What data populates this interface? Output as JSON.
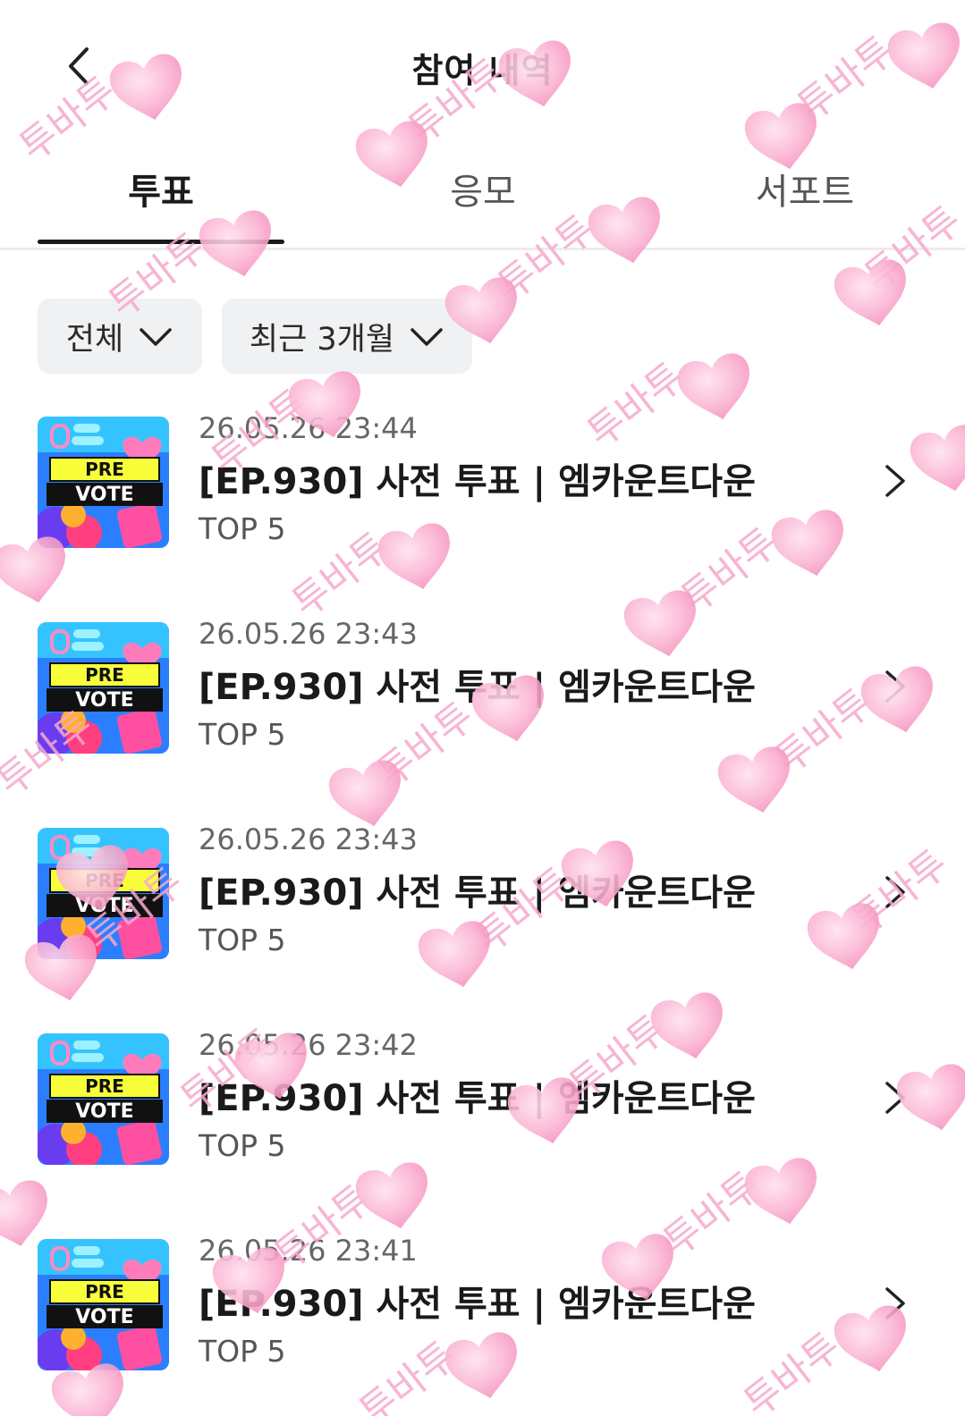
{
  "header": {
    "title": "참여 내역",
    "back_icon": "chevron-left-icon"
  },
  "tabs": [
    {
      "label": "투표",
      "active": true
    },
    {
      "label": "응모",
      "active": false
    },
    {
      "label": "서포트",
      "active": false
    }
  ],
  "filters": {
    "category": "전체",
    "period": "최근 3개월"
  },
  "thumbnail": {
    "line1": "PRE",
    "line2": "VOTE"
  },
  "items": [
    {
      "date": "26.05.26 23:44",
      "title": "[EP.930] 사전 투표 | 엠카운트다운",
      "sub": "TOP 5"
    },
    {
      "date": "26.05.26 23:43",
      "title": "[EP.930] 사전 투표 | 엠카운트다운",
      "sub": "TOP 5"
    },
    {
      "date": "26.05.26 23:43",
      "title": "[EP.930] 사전 투표 | 엠카운트다운",
      "sub": "TOP 5"
    },
    {
      "date": "26.05.26 23:42",
      "title": "[EP.930] 사전 투표 | 엠카운트다운",
      "sub": "TOP 5"
    },
    {
      "date": "26.05.26 23:41",
      "title": "[EP.930] 사전 투표 | 엠카운트다운",
      "sub": "TOP 5"
    }
  ],
  "watermark": {
    "text": "투바투",
    "color": "#f6a9cd"
  },
  "colors": {
    "active_tab": "#1a1a1a",
    "filter_bg": "#f0f1f3",
    "thumb_bg": "#2b7fff"
  }
}
